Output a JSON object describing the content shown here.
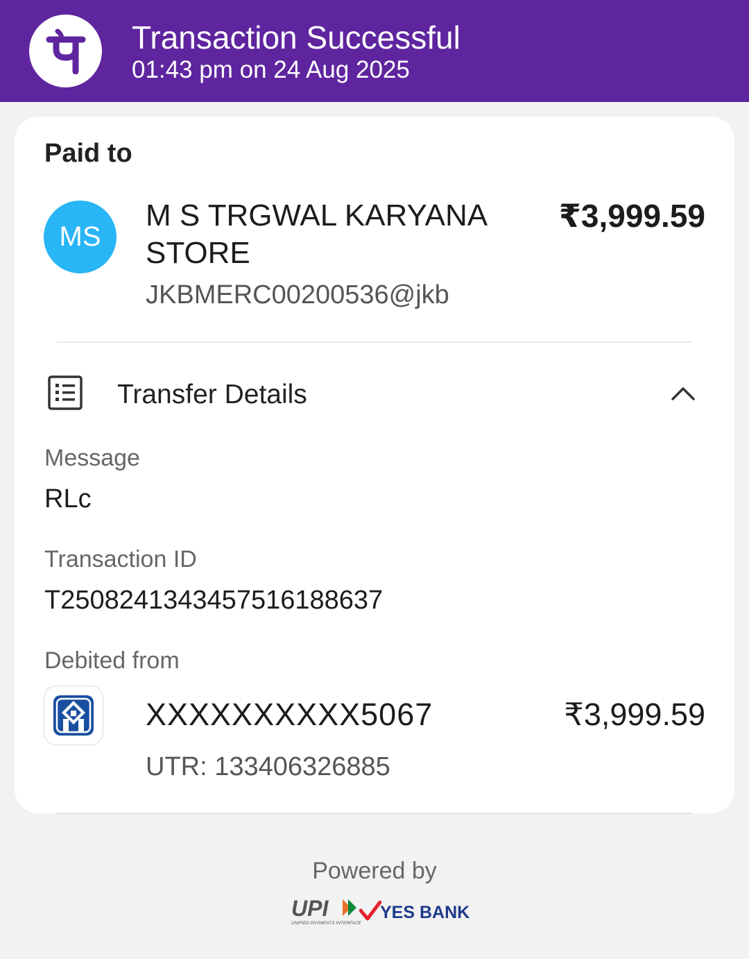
{
  "header": {
    "title": "Transaction Successful",
    "datetime": "01:43 pm on 24 Aug 2025",
    "logo_icon": "phonepe-logo-icon",
    "color": "#5f259f"
  },
  "paid_to": {
    "label": "Paid to",
    "avatar_initials": "MS",
    "avatar_color": "#29b6f6",
    "name": "M S TRGWAL KARYANA STORE",
    "upi_id": "JKBMERC00200536@jkb",
    "amount": "₹3,999.59"
  },
  "transfer_details": {
    "title": "Transfer Details",
    "icon": "receipt-list-icon",
    "toggle_icon": "chevron-up-icon",
    "message_label": "Message",
    "message_value": "RLc",
    "transaction_id_label": "Transaction ID",
    "transaction_id_value": "T2508241343457516188637",
    "debited_from_label": "Debited from",
    "bank_icon": "bank-logo-icon",
    "account": "XXXXXXXXXX5067",
    "amount": "₹3,999.59",
    "utr": "UTR: 133406326885"
  },
  "footer": {
    "powered_by": "Powered by",
    "upi_logo_text": "UPI",
    "upi_tagline": "UNIFIED PAYMENTS INTERFACE",
    "bank_name": "YES BANK"
  }
}
